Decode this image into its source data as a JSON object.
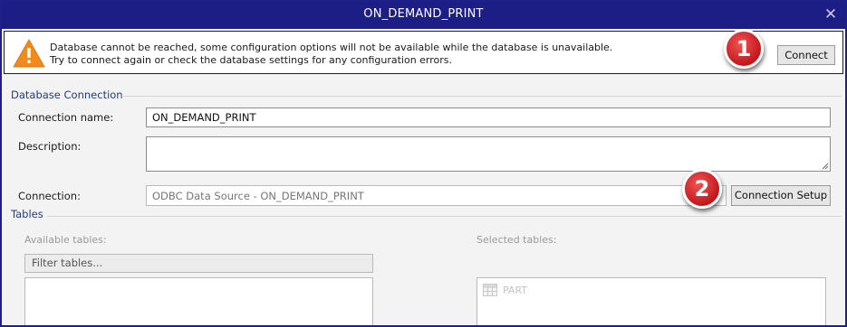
{
  "window": {
    "title": "ON_DEMAND_PRINT",
    "close_glyph": "✕"
  },
  "alert": {
    "icon": "warning-triangle-icon",
    "line1": "Database cannot be reached, some configuration options will not be available while the database is unavailable.",
    "line2": "Try to connect again or check the database settings for any configuration errors.",
    "connect_label": "Connect"
  },
  "badges": [
    "1",
    "2"
  ],
  "database_connection": {
    "section_title": "Database Connection",
    "connection_name_label": "Connection name:",
    "connection_name_value": "ON_DEMAND_PRINT",
    "description_label": "Description:",
    "description_value": "",
    "connection_label": "Connection:",
    "connection_value": "ODBC Data Source - ON_DEMAND_PRINT",
    "connection_setup_label": "Connection Setup"
  },
  "tables": {
    "section_title": "Tables",
    "available_label": "Available tables:",
    "filter_placeholder": "Filter tables...",
    "selected_label": "Selected tables:",
    "selected_items": [
      {
        "name": "PART",
        "icon": "table-icon"
      }
    ]
  },
  "colors": {
    "titlebar": "#1d1d86",
    "accent_text": "#1f3a8a",
    "badge_red": "#d32024",
    "warning_orange": "#f08a1c"
  }
}
